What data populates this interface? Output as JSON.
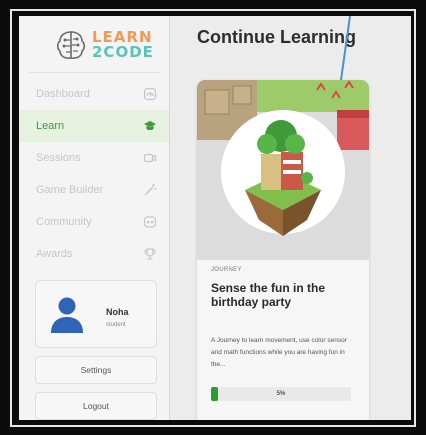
{
  "brand": {
    "line1": "LEARN",
    "line2": "2CODE",
    "color_orange": "#f09a54",
    "color_teal": "#59c3b9"
  },
  "sidebar": {
    "items": [
      {
        "label": "Dashboard",
        "icon": "dashboard-icon",
        "active": false
      },
      {
        "label": "Learn",
        "icon": "graduation-cap-icon",
        "active": true
      },
      {
        "label": "Sessions",
        "icon": "video-icon",
        "active": false
      },
      {
        "label": "Game Builder",
        "icon": "magic-wand-icon",
        "active": false
      },
      {
        "label": "Community",
        "icon": "community-icon",
        "active": false
      },
      {
        "label": "Awards",
        "icon": "trophy-icon",
        "active": false
      }
    ],
    "profile": {
      "name": "Noha",
      "role": "student"
    },
    "settings_label": "Settings",
    "logout_label": "Logout"
  },
  "main": {
    "title": "Continue Learning",
    "card": {
      "tag": "JOURNEY",
      "title": "Sense the fun in the birthday party",
      "description": "A Journey to learn movement, use color sensor and math functions while you are having fun in the...",
      "progress_percent": 5,
      "progress_label": "5%"
    }
  },
  "colors": {
    "accent_green": "#3f9a3a",
    "active_bg": "#e6f2df"
  }
}
